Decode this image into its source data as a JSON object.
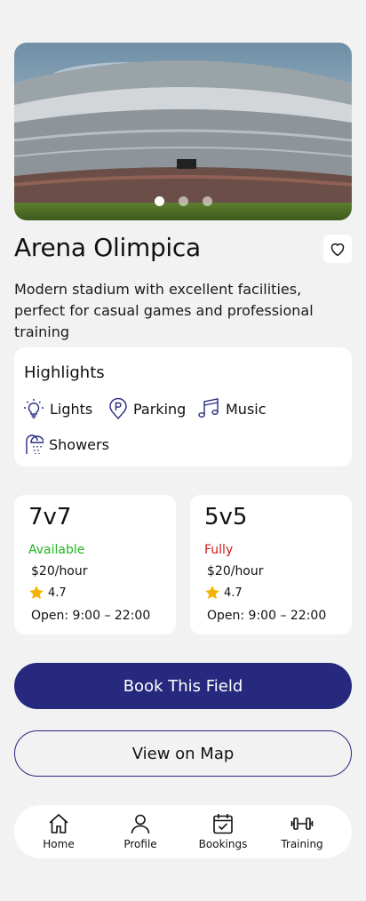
{
  "venue": {
    "name": "Arena Olimpica",
    "description": "Modern stadium with excellent facilities, perfect for casual games and professional training",
    "carousel": {
      "count": 3,
      "active": 1
    }
  },
  "highlights": {
    "title": "Highlights",
    "items": [
      {
        "label": "Lights",
        "icon": "lightbulb-icon"
      },
      {
        "label": "Parking",
        "icon": "parking-icon"
      },
      {
        "label": "Music",
        "icon": "music-icon"
      },
      {
        "label": "Showers",
        "icon": "shower-icon"
      }
    ]
  },
  "fields": [
    {
      "name": "7v7",
      "status": "Available",
      "status_color": "#22b322",
      "price": "$20/hour",
      "rating": "4.7",
      "hours": "Open: 9:00 – 22:00"
    },
    {
      "name": "5v5",
      "status": "Fully",
      "status_color": "#d01818",
      "price": "$20/hour",
      "rating": "4.7",
      "hours": "Open: 9:00 – 22:00"
    }
  ],
  "actions": {
    "book": "Book This Field",
    "map": "View on Map"
  },
  "nav": [
    {
      "label": "Home",
      "icon": "home-icon"
    },
    {
      "label": "Profile",
      "icon": "profile-icon"
    },
    {
      "label": "Bookings",
      "icon": "calendar-check-icon"
    },
    {
      "label": "Training",
      "icon": "dumbbell-icon"
    }
  ],
  "colors": {
    "primary": "#27297f",
    "icon": "#27297f",
    "star": "#f5b400"
  }
}
